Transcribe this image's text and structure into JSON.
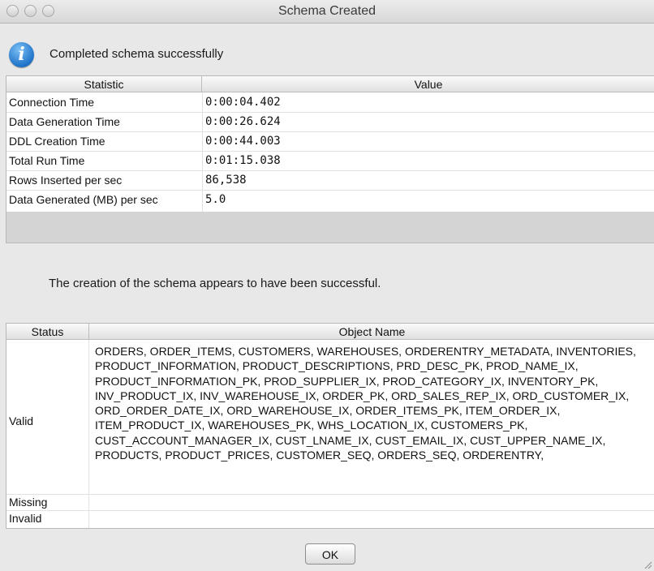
{
  "window": {
    "title": "Schema Created",
    "controls": [
      "close",
      "minimize",
      "zoom"
    ]
  },
  "message": {
    "icon": "info-icon",
    "text": "Completed schema successfully"
  },
  "stats_table": {
    "headers": [
      "Statistic",
      "Value"
    ],
    "rows": [
      {
        "statistic": "Connection Time",
        "value": "0:00:04.402"
      },
      {
        "statistic": "Data Generation Time",
        "value": "0:00:26.624"
      },
      {
        "statistic": "DDL Creation Time",
        "value": "0:00:44.003"
      },
      {
        "statistic": "Total Run Time",
        "value": "0:01:15.038"
      },
      {
        "statistic": "Rows Inserted per sec",
        "value": "86,538"
      },
      {
        "statistic": "Data Generated (MB) per sec",
        "value": "5.0"
      }
    ]
  },
  "success_text": "The creation of the schema appears to have been successful.",
  "status_table": {
    "headers": [
      "Status",
      "Object Name"
    ],
    "rows": [
      {
        "status": "Valid",
        "objects": "ORDERS, ORDER_ITEMS, CUSTOMERS, WAREHOUSES, ORDERENTRY_METADATA, INVENTORIES, PRODUCT_INFORMATION, PRODUCT_DESCRIPTIONS, PRD_DESC_PK, PROD_NAME_IX, PRODUCT_INFORMATION_PK, PROD_SUPPLIER_IX, PROD_CATEGORY_IX, INVENTORY_PK, INV_PRODUCT_IX, INV_WAREHOUSE_IX, ORDER_PK, ORD_SALES_REP_IX, ORD_CUSTOMER_IX, ORD_ORDER_DATE_IX, ORD_WAREHOUSE_IX, ORDER_ITEMS_PK, ITEM_ORDER_IX, ITEM_PRODUCT_IX, WAREHOUSES_PK, WHS_LOCATION_IX, CUSTOMERS_PK, CUST_ACCOUNT_MANAGER_IX, CUST_LNAME_IX, CUST_EMAIL_IX, CUST_UPPER_NAME_IX, PRODUCTS, PRODUCT_PRICES, CUSTOMER_SEQ, ORDERS_SEQ, ORDERENTRY,"
      },
      {
        "status": "Missing",
        "objects": ""
      },
      {
        "status": "Invalid",
        "objects": ""
      }
    ]
  },
  "buttons": {
    "ok_label": "OK"
  }
}
